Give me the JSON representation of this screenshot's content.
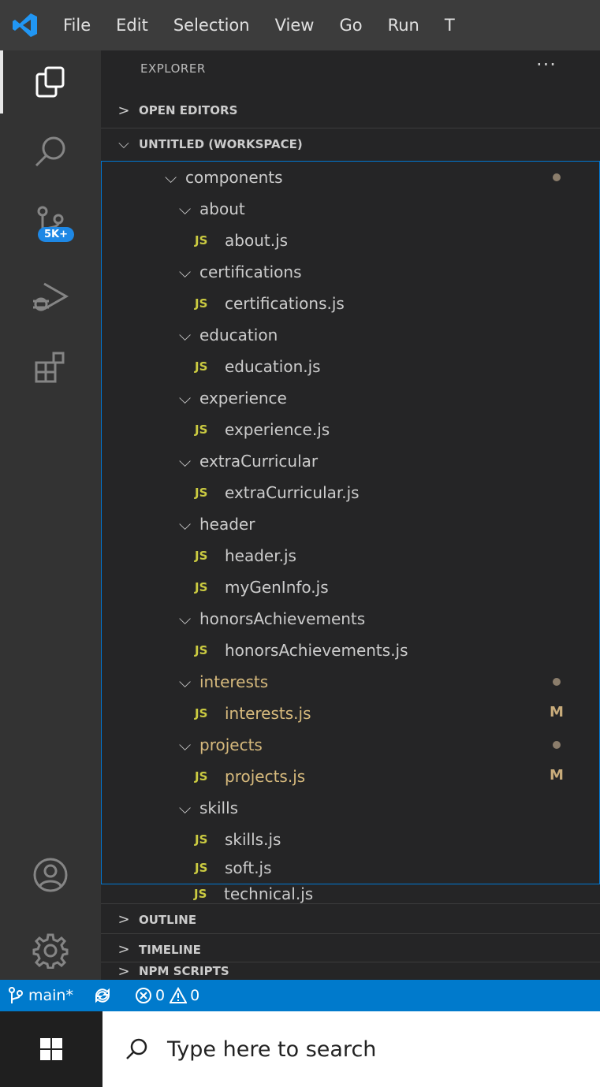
{
  "menubar": {
    "items": [
      "File",
      "Edit",
      "Selection",
      "View",
      "Go",
      "Run",
      "T"
    ]
  },
  "activity": {
    "icons": [
      "explorer-icon",
      "search-icon",
      "source-control-icon",
      "run-debug-icon",
      "extensions-icon",
      "accounts-icon",
      "manage-gear-icon"
    ],
    "badge": "5K+"
  },
  "sidebar": {
    "title": "EXPLORER",
    "more": "···",
    "open_editors": "OPEN EDITORS",
    "workspace": "UNTITLED (WORKSPACE)",
    "outline": "OUTLINE",
    "timeline": "TIMELINE",
    "npm_scripts": "NPM SCRIPTS"
  },
  "tree": {
    "folder_components": "components",
    "folder_about": "about",
    "file_about": "about.js",
    "folder_certifications": "certifications",
    "file_certifications": "certifications.js",
    "folder_education": "education",
    "file_education": "education.js",
    "folder_experience": "experience",
    "file_experience": "experience.js",
    "folder_extra": "extraCurricular",
    "file_extra": "extraCurricular.js",
    "folder_header": "header",
    "file_header": "header.js",
    "file_mygen": "myGenInfo.js",
    "folder_honors": "honorsAchievements",
    "file_honors": "honorsAchievements.js",
    "folder_interests": "interests",
    "file_interests": "interests.js",
    "folder_projects": "projects",
    "file_projects": "projects.js",
    "folder_skills": "skills",
    "file_skills": "skills.js",
    "file_soft": "soft.js",
    "file_technical": "technical.js",
    "js_label": "JS",
    "modified_label": "M"
  },
  "statusbar": {
    "branch": "main*",
    "errors": "0",
    "warnings": "0"
  },
  "taskbar": {
    "search_placeholder": "Type here to search"
  },
  "colors": {
    "statusbar": "#007acc",
    "js_icon": "#cbcb41",
    "modified": "#d7ba7d",
    "tree_focus_border": "#0078d4"
  }
}
